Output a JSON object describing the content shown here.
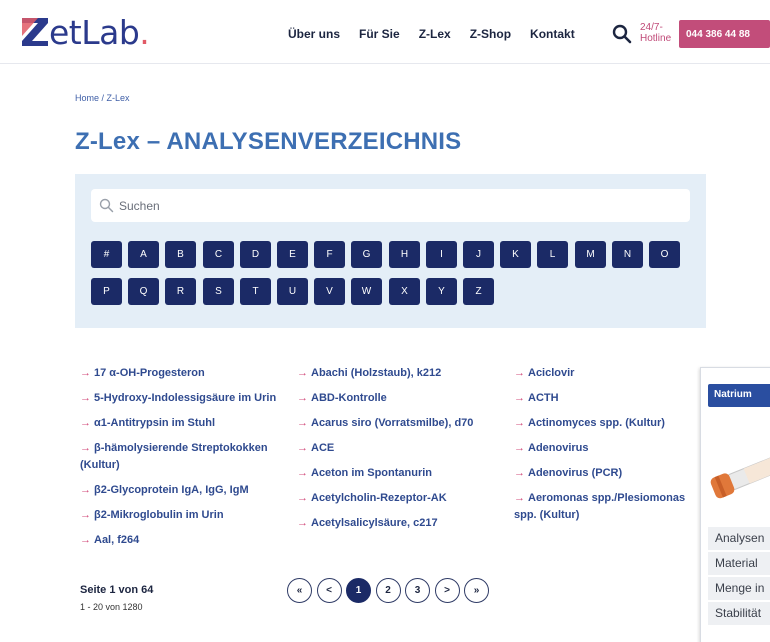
{
  "header": {
    "logo": {
      "text": "ZetLab",
      "letters": "etLab",
      "dot": "."
    },
    "nav": [
      "Über uns",
      "Für Sie",
      "Z-Lex",
      "Z-Shop",
      "Kontakt"
    ],
    "hotline_label_1": "24/7-",
    "hotline_label_2": "Hotline",
    "hotline_number": "044 386 44 88"
  },
  "breadcrumb": "Home / Z-Lex",
  "title": "Z-Lex – ANALYSENVERZEICHNIS",
  "search": {
    "placeholder": "Suchen"
  },
  "letters": [
    "#",
    "A",
    "B",
    "C",
    "D",
    "E",
    "F",
    "G",
    "H",
    "I",
    "J",
    "K",
    "L",
    "M",
    "N",
    "O",
    "P",
    "Q",
    "R",
    "S",
    "T",
    "U",
    "V",
    "W",
    "X",
    "Y",
    "Z"
  ],
  "columns": [
    [
      "17 α-OH-Progesteron",
      "5-Hydroxy-Indolessigsäure im Urin",
      "α1-Antitrypsin im Stuhl",
      "β-hämolysierende Streptokokken (Kultur)",
      "β2-Glycoprotein IgA, IgG, IgM",
      "β2-Mikroglobulin im Urin",
      "Aal, f264"
    ],
    [
      "Abachi (Holzstaub), k212",
      "ABD-Kontrolle",
      "Acarus siro (Vorratsmilbe), d70",
      "ACE",
      "Aceton im Spontanurin",
      "Acetylcholin-Rezeptor-AK",
      "Acetylsalicylsäure, c217"
    ],
    [
      "Aciclovir",
      "ACTH",
      "Actinomyces spp. (Kultur)",
      "Adenovirus",
      "Adenovirus (PCR)",
      "Aeromonas spp./Plesiomonas spp. (Kultur)"
    ]
  ],
  "arrow": "→",
  "pagination": {
    "page_label": "Seite 1 von 64",
    "range_label": "1 - 20 von 1280",
    "buttons": [
      "«",
      "<",
      "1",
      "2",
      "3",
      ">",
      "»"
    ],
    "current": "1"
  },
  "card": {
    "tag": "Natrium",
    "rows": [
      "Analysen",
      "Material",
      "Menge in",
      "Stabilität"
    ]
  },
  "colors": {
    "brand": "#2b3a8c",
    "accent": "#c24d7a",
    "letter_bg": "#1b2a66",
    "panel_bg": "#e4eef7",
    "title": "#3d6fb2"
  }
}
